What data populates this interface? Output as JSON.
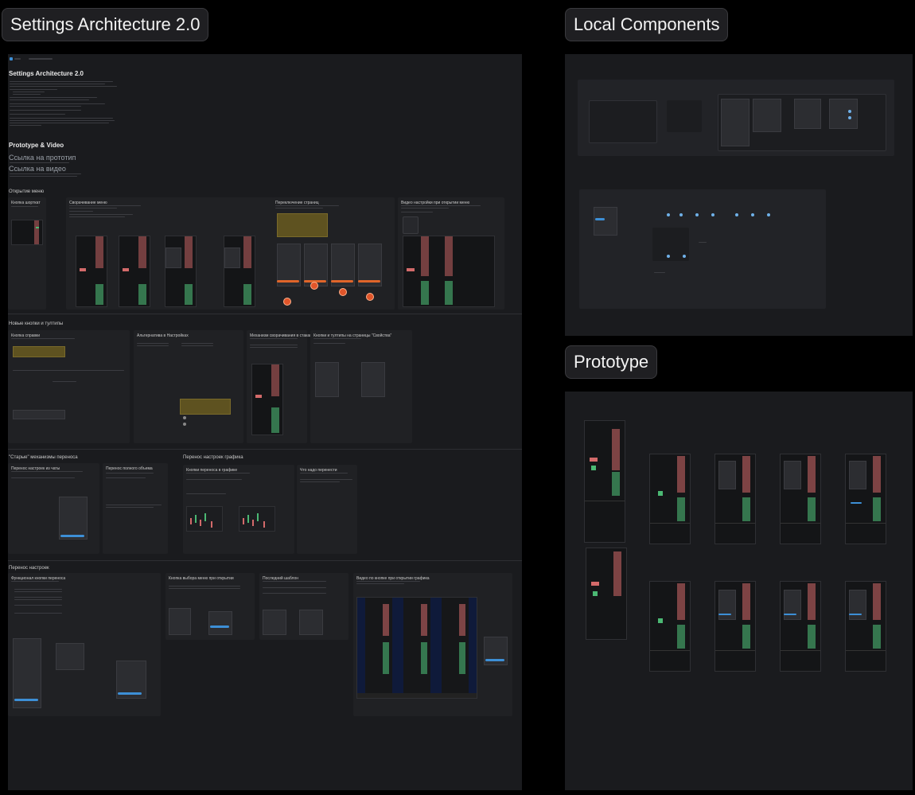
{
  "frames": {
    "settings_title": "Settings Architecture 2.0",
    "components_title": "Local Components",
    "prototype_title": "Prototype"
  },
  "doc": {
    "heading": "Settings Architecture 2.0",
    "prototype_video_heading": "Prototype & Video",
    "prototype_link": "Ссылка на прототип",
    "video_link": "Ссылка на видео",
    "sections": {
      "s1": "Открытие меню",
      "s2": "Новые кнопки и тултипы",
      "s3": "\"Старые\" механизмы переноса",
      "s3b": "Перенос настроек графика",
      "s4": "Перенос настроек"
    },
    "cards": {
      "c1": "Кнопка шорткат",
      "c2": "Сворачивание меню",
      "c3": "Переключение страниц",
      "c4": "Видео настройки при открытии меню",
      "c5": "Кнопка справки",
      "c6": "Альтернатива в Настройках",
      "c7": "Механизм сворачивания в стакане",
      "c8": "Кнопки и тултипы на страницы \"Свойства\"",
      "c9": "Перенос настроек из чаты",
      "c10": "Перенос полного объема",
      "c11": "Кнопки переноса в графике",
      "c12": "Что надо перенести",
      "c13": "Функционал кнопки переноса",
      "c14": "Кнопка выбора меню при открытии",
      "c15": "Последний шаблон",
      "c16": "Видео по кнопке при открытии графика"
    }
  },
  "colors": {
    "background": "#000000",
    "frame": "#1a1b1e",
    "card": "#202124",
    "accent_blue": "#3d8fd6",
    "accent_orange": "#e0652a",
    "bull": "#4bb873",
    "bear": "#d36a6a"
  },
  "icons": {
    "breadcrumb_logo": "app-logo-icon",
    "error_markers": "alert-circle-icon"
  }
}
